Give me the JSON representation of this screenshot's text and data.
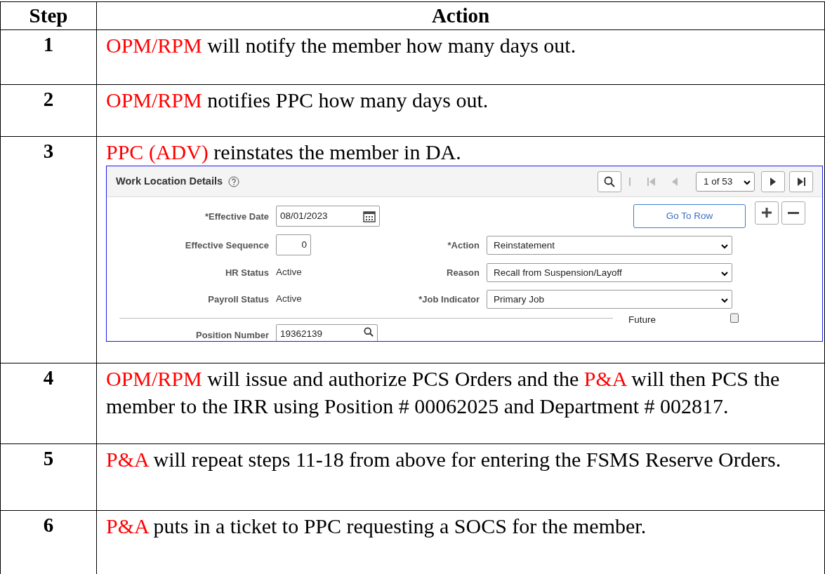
{
  "table": {
    "columns": [
      "Step",
      "Action"
    ],
    "rows": [
      {
        "step": "1",
        "parts": [
          {
            "kind": "red",
            "text": "OPM/RPM"
          },
          {
            "kind": "plain",
            "text": " will notify the member how many days out."
          }
        ]
      },
      {
        "step": "2",
        "parts": [
          {
            "kind": "red",
            "text": "OPM/RPM"
          },
          {
            "kind": "plain",
            "text": " notifies PPC how many days out."
          }
        ]
      },
      {
        "step": "3",
        "parts": [
          {
            "kind": "red",
            "text": "PPC (ADV)"
          },
          {
            "kind": "plain",
            "text": " reinstates the member in DA."
          }
        ],
        "screenshot": true
      },
      {
        "step": "4",
        "parts": [
          {
            "kind": "red",
            "text": "OPM/RPM"
          },
          {
            "kind": "plain",
            "text": " will issue and authorize PCS Orders and the "
          },
          {
            "kind": "red",
            "text": "P&A"
          },
          {
            "kind": "plain",
            "text": " will then PCS the member to the IRR using Position # 00062025 and Department # 002817."
          }
        ]
      },
      {
        "step": "5",
        "parts": [
          {
            "kind": "red",
            "text": "P&A"
          },
          {
            "kind": "plain",
            "text": " will repeat steps 11-18 from above for entering the FSMS Reserve Orders."
          }
        ]
      },
      {
        "step": "6",
        "parts": [
          {
            "kind": "red",
            "text": "P&A"
          },
          {
            "kind": "plain",
            "text": " puts in a ticket to PPC requesting a SOCS for the member."
          }
        ]
      }
    ]
  },
  "screenshot": {
    "title": "Work Location Details",
    "pager": "1 of 53",
    "go_to_row": "Go To Row",
    "effective_date": {
      "label": "*Effective Date",
      "value": "08/01/2023"
    },
    "effective_sequence": {
      "label": "Effective Sequence",
      "value": "0"
    },
    "hr_status": {
      "label": "HR Status",
      "value": "Active"
    },
    "payroll_status": {
      "label": "Payroll Status",
      "value": "Active"
    },
    "action": {
      "label": "*Action",
      "value": "Reinstatement"
    },
    "reason": {
      "label": "Reason",
      "value": "Recall from Suspension/Layoff"
    },
    "job_indicator": {
      "label": "*Job Indicator",
      "value": "Primary Job"
    },
    "future": "Future",
    "position_number": {
      "label": "Position Number",
      "value": "19362139"
    }
  }
}
